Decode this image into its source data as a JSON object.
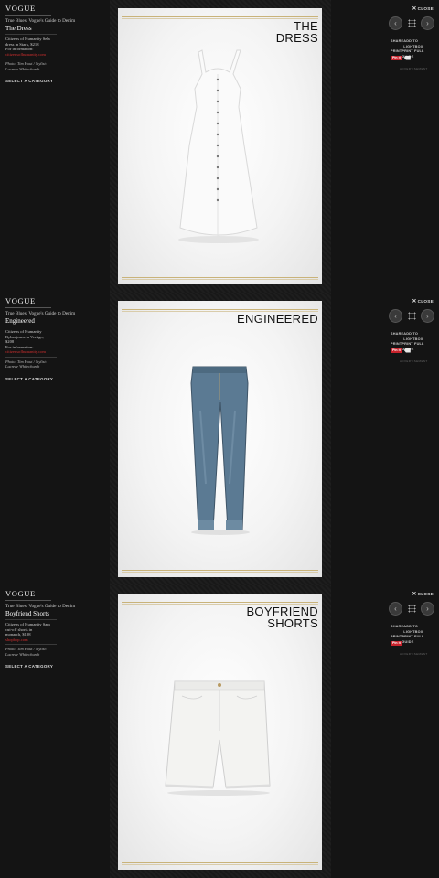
{
  "panels": [
    {
      "brand": "VOGUE",
      "kicker": "True Blues: Vogue's Guide to Denim",
      "item_title": "The Dress",
      "desc_lines": [
        "Citizens of Humanity Sela",
        "dress in Stark, $218",
        "For information:"
      ],
      "link": "citizensofhumanity.com",
      "credit_lines": [
        "Photo: Tim Hout / Stylist:",
        "Lucrece Whitechurch"
      ],
      "select_category": "SELECT A CATEGORY",
      "photo_title": "THE\nDRESS",
      "close": "CLOSE",
      "share": "SHARE",
      "add_lightbox": "ADD TO LIGHTBOX",
      "print": "PRINT",
      "print_full_guide": "PRINT FULL GUIDE",
      "pin_label": "Pin it",
      "advertisement": "ADVERTISEMENT",
      "prev_icon": "chevron-left-icon",
      "next_icon": "chevron-right-icon",
      "grid_icon": "grid-icon"
    },
    {
      "brand": "VOGUE",
      "kicker": "True Blues: Vogue's Guide to Denim",
      "item_title": "Engineered",
      "desc_lines": [
        "Citizens of Humanity",
        "Rylan jeans in Vertigo,",
        "$208",
        "For information:"
      ],
      "link": "citizensofhumanity.com",
      "credit_lines": [
        "Photo: Tim Hout / Stylist:",
        "Lucrece Whitechurch"
      ],
      "select_category": "SELECT A CATEGORY",
      "photo_title": "ENGINEERED",
      "close": "CLOSE",
      "share": "SHARE",
      "add_lightbox": "ADD TO LIGHTBOX",
      "print": "PRINT",
      "print_full_guide": "PRINT FULL GUIDE",
      "pin_label": "Pin it",
      "advertisement": "ADVERTISEMENT",
      "prev_icon": "chevron-left-icon",
      "next_icon": "chevron-right-icon",
      "grid_icon": "grid-icon"
    },
    {
      "brand": "VOGUE",
      "kicker": "True Blues: Vogue's Guide to Denim",
      "item_title": "Boyfriend Shorts",
      "desc_lines": [
        "Citizens of Humanity Sam",
        "cut-off shorts in",
        "monarch, $198"
      ],
      "link": "shopbop.com",
      "credit_lines": [
        "Photo: Tim Hout / Stylist:",
        "Lucrece Whitechurch"
      ],
      "select_category": "SELECT A CATEGORY",
      "photo_title": "BOYFRIEND\nSHORTS",
      "close": "CLOSE",
      "share": "SHARE",
      "add_lightbox": "ADD TO LIGHTBOX",
      "print": "PRINT",
      "print_full_guide": "PRINT FULL GUIDE",
      "pin_label": "Pin it",
      "advertisement": "ADVERTISEMENT",
      "prev_icon": "chevron-left-icon",
      "next_icon": "chevron-right-icon",
      "grid_icon": "grid-icon"
    }
  ],
  "colors": {
    "link": "#d12f2f",
    "gold": "#c9b37a",
    "pin": "#c8232c",
    "denim": "#5b7a93"
  }
}
